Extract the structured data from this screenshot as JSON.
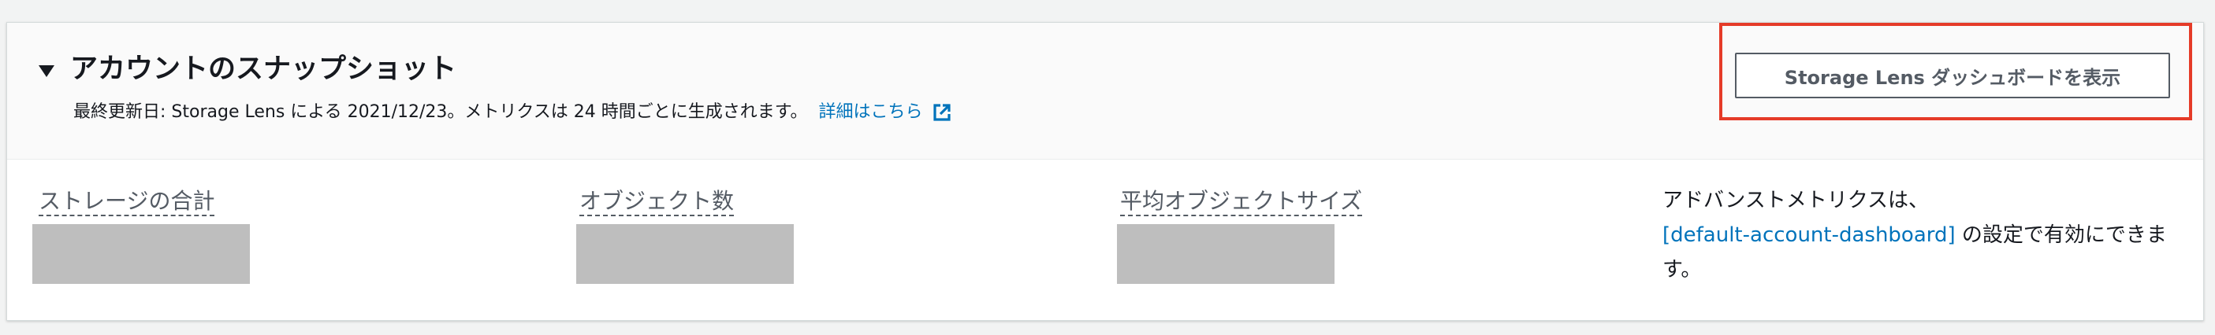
{
  "header": {
    "title": "アカウントのスナップショット",
    "subtitle": "最終更新日: Storage Lens による 2021/12/23。メトリクスは 24 時間ごとに生成されます。",
    "details_link": "詳細はこちら",
    "dashboard_button_label": "Storage Lens ダッシュボードを表示"
  },
  "metrics": [
    {
      "label": "ストレージの合計"
    },
    {
      "label": "オブジェクト数"
    },
    {
      "label": "平均オブジェクトサイズ"
    }
  ],
  "advanced_note": {
    "prefix": "アドバンストメトリクスは、",
    "link": "[default-account-dashboard]",
    "suffix": " の設定で有効にできます。"
  },
  "colors": {
    "link": "#0073bb",
    "highlight": "#e53b28",
    "placeholder": "#bebebe"
  },
  "icons": {
    "collapse": "caret-down-icon",
    "external_link": "external-link-icon"
  }
}
